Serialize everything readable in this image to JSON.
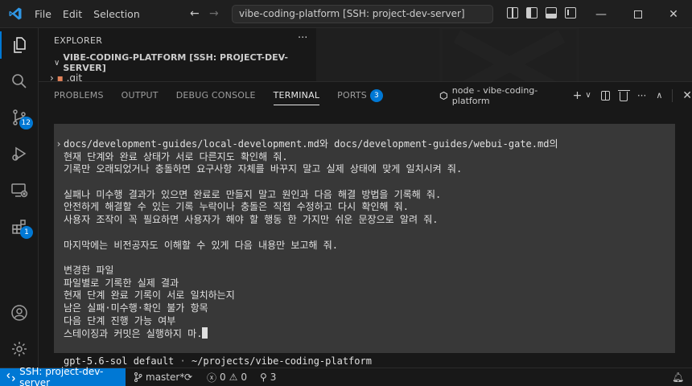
{
  "titlebar": {
    "menu": [
      "File",
      "Edit",
      "Selection"
    ],
    "command_center": "vibe-coding-platform [SSH: project-dev-server]"
  },
  "activity": {
    "source_control_badge": "12",
    "extensions_badge": "1"
  },
  "explorer": {
    "title": "EXPLORER",
    "more": "···",
    "folder": "VIBE-CODING-PLATFORM [SSH: PROJECT-DEV-SERVER]",
    "child": ".git"
  },
  "panel": {
    "tabs": [
      "PROBLEMS",
      "OUTPUT",
      "DEBUG CONSOLE",
      "TERMINAL",
      "PORTS"
    ],
    "ports_badge": "3",
    "terminal_name": "node - vibe-coding-platform"
  },
  "terminal": {
    "lines": [
      "docs/development-guides/local-development.md와 docs/development-guides/webui-gate.md의",
      "현재 단계와 완료 상태가 서로 다른지도 확인해 줘.",
      "기록만 오래되었거나 충돌하면 요구사항 자체를 바꾸지 말고 실제 상태에 맞게 일치시켜 줘.",
      "",
      "실패나 미수행 결과가 있으면 완료로 만들지 말고 원인과 다음 해결 방법을 기록해 줘.",
      "안전하게 해결할 수 있는 기록 누락이나 충돌은 직접 수정하고 다시 확인해 줘.",
      "사용자 조작이 꼭 필요하면 사용자가 해야 할 행동 한 가지만 쉬운 문장으로 알려 줘.",
      "",
      "마지막에는 비전공자도 이해할 수 있게 다음 내용만 보고해 줘.",
      "",
      "변경한 파일",
      "파일별로 기록한 실제 결과",
      "현재 단계 완료 기록이 서로 일치하는지",
      "남은 실패·미수행·확인 불가 항목",
      "다음 단계 진행 가능 여부",
      "스테이징과 커밋은 실행하지 마."
    ],
    "model": "gpt-5.6-sol default",
    "separator": "·",
    "path": "~/projects/vibe-coding-platform"
  },
  "statusbar": {
    "remote": "SSH: project-dev-server",
    "branch": "master*",
    "errors": "0",
    "warnings": "0",
    "ports": "3"
  },
  "colors": {
    "accent": "#0078d4",
    "background": "#1f1f1f",
    "terminal_box": "#383838"
  }
}
